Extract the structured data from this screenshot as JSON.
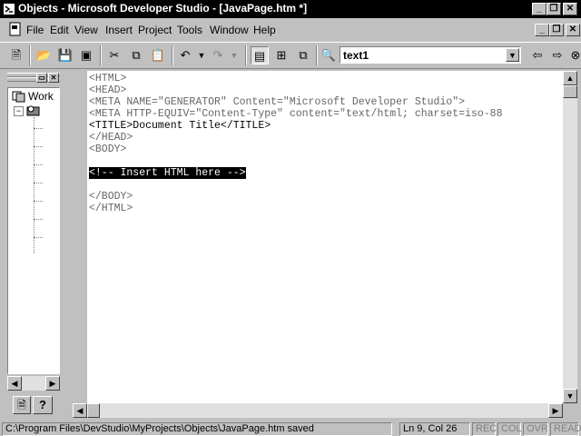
{
  "window": {
    "title": "Objects - Microsoft Developer Studio - [JavaPage.htm *]"
  },
  "menu": {
    "items": [
      "File",
      "Edit",
      "View",
      "Insert",
      "Project",
      "Tools",
      "Window",
      "Help"
    ]
  },
  "toolbar": {
    "find_value": "text1"
  },
  "workspace": {
    "tree_root_label": "Work"
  },
  "editor": {
    "lines": [
      "<HTML>",
      "<HEAD>",
      "<META NAME=\"GENERATOR\" Content=\"Microsoft Developer Studio\">",
      "<META HTTP-EQUIV=\"Content-Type\" content=\"text/html; charset=iso-88",
      "<TITLE>Document Title</TITLE>",
      "</HEAD>",
      "<BODY>",
      "",
      "<!-- Insert HTML here -->",
      "",
      "</BODY>",
      "</HTML>"
    ],
    "highlighted_line_index": 8
  },
  "status": {
    "message": "C:\\Program Files\\DevStudio\\MyProjects\\Objects\\JavaPage.htm saved",
    "position": "Ln 9, Col 26",
    "rec": "REC",
    "col": "COL",
    "ovr": "OVR",
    "read": "READ"
  }
}
